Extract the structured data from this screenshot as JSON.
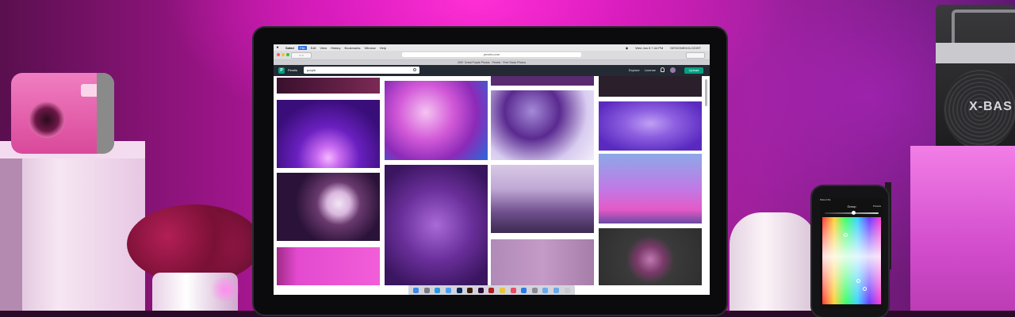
{
  "scene": {
    "props": {
      "speaker_brand": "X-BAS"
    }
  },
  "laptop_screen": {
    "menubar": {
      "app": "Safari",
      "items": [
        "File",
        "Edit",
        "View",
        "History",
        "Bookmarks",
        "Window",
        "Help"
      ],
      "active_item": "File",
      "clock": "Wed Jan 8 7:44 PM",
      "user": "DESIGNEDOLOGIST"
    },
    "browser": {
      "url": "pexels.com",
      "tab_title": "200+ Great Purple Photos · Pexels · Free Stock Photos",
      "nav_label": "< >"
    },
    "site": {
      "logo_letter": "P",
      "logo_text": "Pexels",
      "search_value": "purple",
      "nav": {
        "explore": "Explore",
        "license": "License",
        "upload": "Upload"
      }
    },
    "gallery_colors": [
      "#5b2045",
      "#4a1580",
      "#2a1238",
      "#c23ca8",
      "#7a2fb0",
      "#d8c8e4",
      "#7b5f96",
      "#b08ab8",
      "#2b1f2b",
      "#8d7fd6",
      "#c07ae6",
      "#3a3a3a"
    ],
    "dock_icon_count": 24
  },
  "phone_screen": {
    "status": "Paired 3G",
    "title": "Group",
    "right_label": "Presets"
  }
}
